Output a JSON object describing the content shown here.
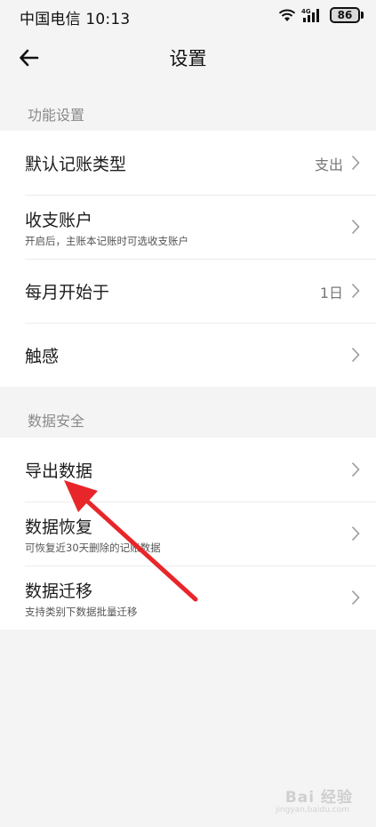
{
  "status_bar": {
    "carrier_time": "中国电信 10:13",
    "network": "4G",
    "battery": "86"
  },
  "nav": {
    "title": "设置"
  },
  "sections": {
    "function": {
      "header": "功能设置",
      "rows": [
        {
          "title": "默认记账类型",
          "value": "支出"
        },
        {
          "title": "收支账户",
          "subtitle": "开启后，主账本记账时可选收支账户"
        },
        {
          "title": "每月开始于",
          "value": "1日"
        },
        {
          "title": "触感"
        }
      ]
    },
    "data_security": {
      "header": "数据安全",
      "rows": [
        {
          "title": "导出数据"
        },
        {
          "title": "数据恢复",
          "subtitle": "可恢复近30天删除的记账数据"
        },
        {
          "title": "数据迁移",
          "subtitle": "支持类别下数据批量迁移"
        }
      ]
    }
  },
  "annotation": {
    "arrow_color": "#e8262a"
  },
  "watermark": {
    "text": "Bai 经验",
    "sub": "jingyan.baidu.com"
  }
}
